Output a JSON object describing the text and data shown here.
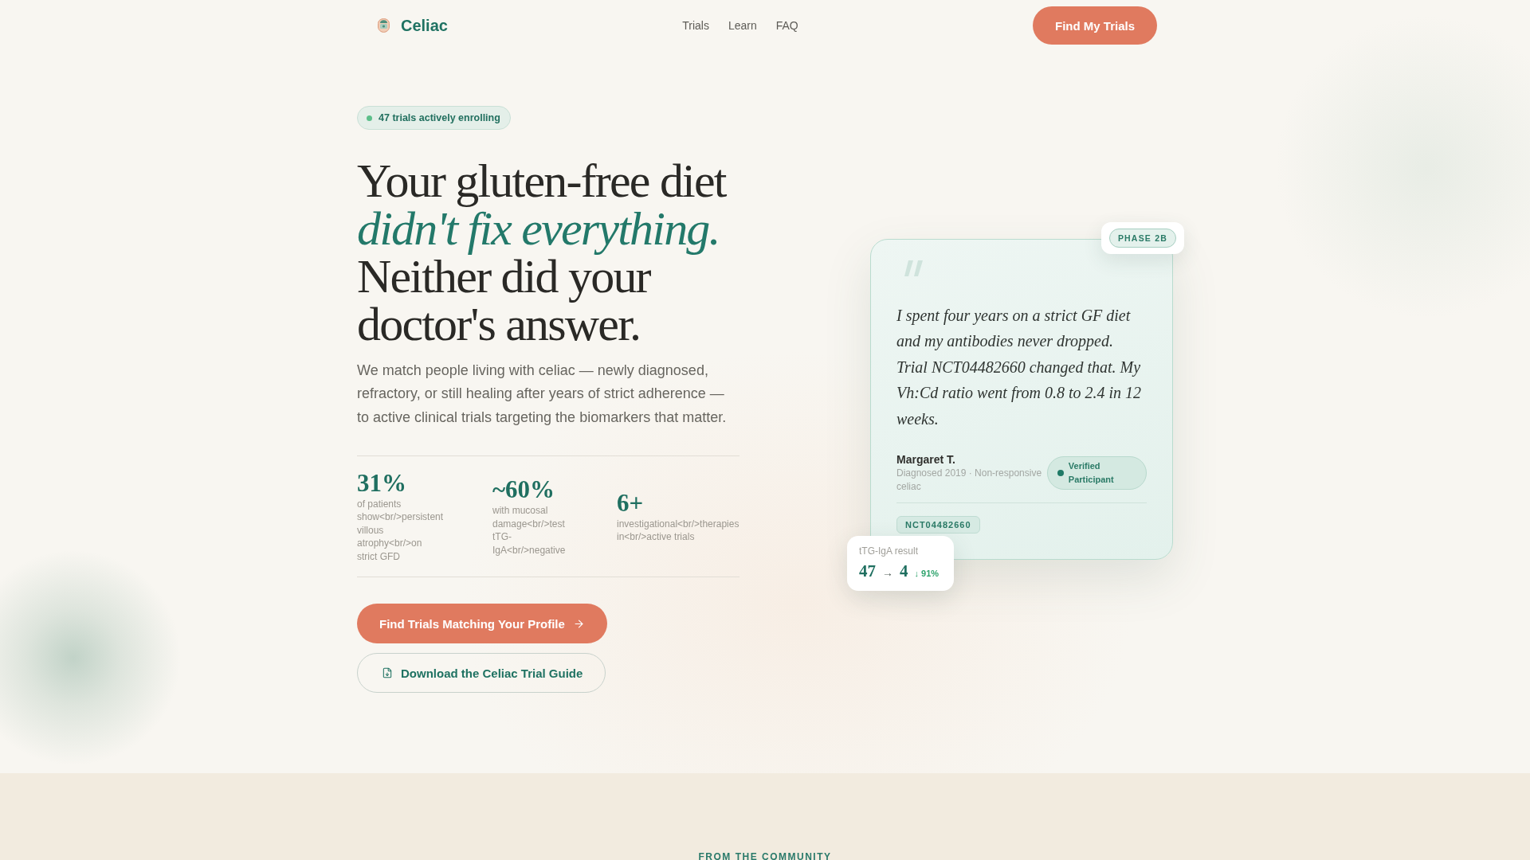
{
  "nav": {
    "brand": "Celiac",
    "links": [
      "Trials",
      "Learn",
      "FAQ"
    ],
    "cta": "Find My Trials"
  },
  "hero": {
    "badge": "47 trials actively enrolling",
    "headline": "Your gluten-free diet *didn't fix everything.* Neither did your doctor's answer.",
    "description": "We match people living with celiac — newly diagnosed, refractory, or still healing after years of strict adherence — to active clinical trials targeting the biomarkers that matter.",
    "stats": [
      {
        "value": "31%",
        "label": "of patients show<br/>persistent villous atrophy<br/>on strict GFD"
      },
      {
        "value": "~60%",
        "label": "with mucosal damage<br/>test tTG-IgA<br/>negative"
      },
      {
        "value": "6+",
        "label": "investigational<br/>therapies in<br/>active trials"
      }
    ],
    "primary_cta": "Find Trials Matching Your Profile",
    "secondary_cta": "Download the Celiac Trial Guide"
  },
  "testimonial": {
    "phase": "PHASE 2B",
    "quote": "I spent four years on a strict GF diet and my antibodies never dropped. Trial NCT04482660 changed that. My Vh:Cd ratio went from 0.8 to 2.4 in 12 weeks.",
    "author": "Margaret T.",
    "meta": "Diagnosed 2019 · Non-responsive celiac",
    "verified": "Verified Participant",
    "trial_id": "NCT04482660",
    "result": {
      "label": "tTG-IgA result",
      "before": "47",
      "arrow": "→",
      "after": "4",
      "change": "↓ 91%"
    }
  },
  "community": {
    "eyebrow": "FROM THE COMMUNITY"
  }
}
